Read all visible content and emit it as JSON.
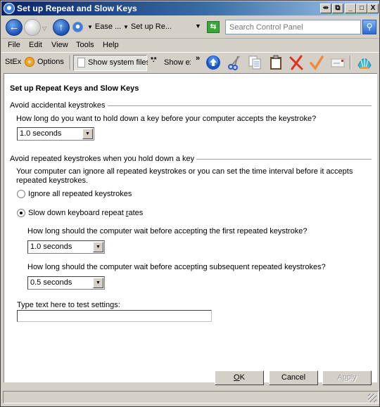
{
  "window": {
    "title": "Set up Repeat and Slow Keys",
    "controls": {
      "pin": "⇹",
      "restore_alt": "⧉",
      "minimize": "_",
      "maximize": "□",
      "close": "X"
    }
  },
  "nav": {
    "back_icon": "←",
    "forward_icon": "→",
    "dropdown_icon": "▽",
    "up_icon": "↑",
    "breadcrumbs": [
      "Ease ...",
      "Set up Re..."
    ],
    "breadcrumb_arrow": "▼",
    "address_dropdown": "▼",
    "refresh_icon": "⇆",
    "search_placeholder": "Search Control Panel",
    "search_icon": "⚲"
  },
  "menu": [
    "File",
    "Edit",
    "View",
    "Tools",
    "Help"
  ],
  "toolbar": {
    "stex_label": "StEx",
    "options_label": "Options",
    "show_system_files_label": "Show system files",
    "show_ext_label": "Show ex",
    "show_ext_icon": "*.*",
    "more_chevron": "»",
    "icons": [
      "up-arrow",
      "cut",
      "copy",
      "paste",
      "delete",
      "check",
      "email",
      "shell"
    ]
  },
  "content": {
    "page_title": "Set up Repeat Keys and Slow Keys",
    "group1": {
      "label": "Avoid accidental keystrokes",
      "question": "How long do you want to hold down a key before your computer accepts the keystroke?",
      "combo_value": "1.0 seconds"
    },
    "group2": {
      "label": "Avoid repeated keystrokes when you hold down a key",
      "description": "Your computer can ignore all repeated keystrokes or you can set the time interval before it accepts repeated keystrokes.",
      "radio_ignore": {
        "pre": "I",
        "accel": "g",
        "post": "nore all repeated keystrokes",
        "checked": false
      },
      "radio_slow": {
        "pre": "Slow down keyboard repeat ",
        "accel": "r",
        "post": "ates",
        "checked": true
      },
      "first_question": "How long should the computer wait before accepting the first repeated keystroke?",
      "first_value": "1.0 seconds",
      "subsequent_question": "How long should the computer wait before accepting subsequent repeated keystrokes?",
      "subsequent_value": "0.5 seconds"
    },
    "test_label": "Type text here to test settings:",
    "test_value": ""
  },
  "buttons": {
    "ok": {
      "accel": "O",
      "rest": "K"
    },
    "cancel": "Cancel",
    "apply": {
      "pre": "A",
      "accel": "p",
      "post": "ply"
    }
  }
}
